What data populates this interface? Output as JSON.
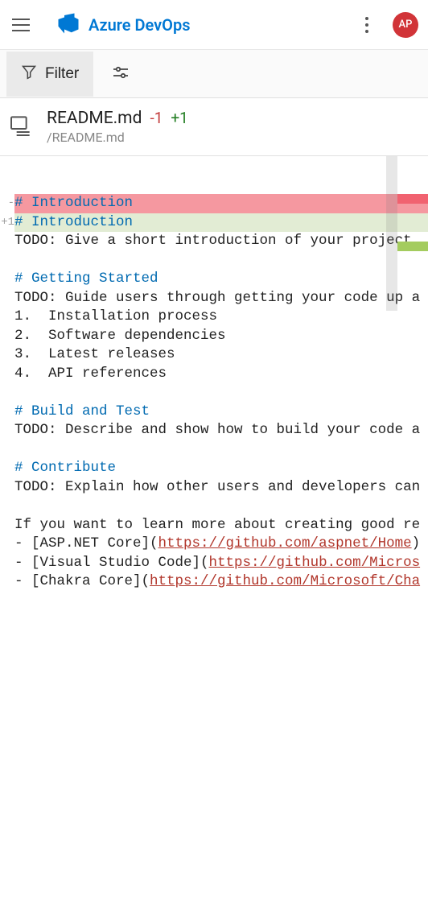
{
  "header": {
    "brand": "Azure DevOps",
    "avatar_initials": "AP"
  },
  "toolbar": {
    "filter_label": "Filter"
  },
  "file": {
    "name": "README.md",
    "removed": "-1",
    "added": "+1",
    "path": "/README.md"
  },
  "diff": {
    "lines": [
      {
        "type": "removed",
        "gutter": "-",
        "spans": [
          {
            "cls": "md-heading",
            "t": "# Introduction"
          }
        ]
      },
      {
        "type": "added",
        "gutter": "+1",
        "spans": [
          {
            "cls": "md-heading",
            "t": "# Introduction "
          }
        ]
      },
      {
        "type": "context",
        "gutter": "",
        "spans": [
          {
            "cls": "plain",
            "t": "TODO: Give a short introduction of your project"
          }
        ]
      },
      {
        "type": "context",
        "gutter": "",
        "spans": [
          {
            "cls": "plain",
            "t": ""
          }
        ]
      },
      {
        "type": "context",
        "gutter": "",
        "spans": [
          {
            "cls": "md-heading",
            "t": "# Getting Started"
          }
        ]
      },
      {
        "type": "context",
        "gutter": "",
        "spans": [
          {
            "cls": "plain",
            "t": "TODO: Guide users through getting your code up a"
          }
        ]
      },
      {
        "type": "context",
        "gutter": "",
        "spans": [
          {
            "cls": "plain",
            "t": "1.  Installation process"
          }
        ]
      },
      {
        "type": "context",
        "gutter": "",
        "spans": [
          {
            "cls": "plain",
            "t": "2.  Software dependencies"
          }
        ]
      },
      {
        "type": "context",
        "gutter": "",
        "spans": [
          {
            "cls": "plain",
            "t": "3.  Latest releases"
          }
        ]
      },
      {
        "type": "context",
        "gutter": "",
        "spans": [
          {
            "cls": "plain",
            "t": "4.  API references"
          }
        ]
      },
      {
        "type": "context",
        "gutter": "",
        "spans": [
          {
            "cls": "plain",
            "t": ""
          }
        ]
      },
      {
        "type": "context",
        "gutter": "",
        "spans": [
          {
            "cls": "md-heading",
            "t": "# Build and Test"
          }
        ]
      },
      {
        "type": "context",
        "gutter": "",
        "spans": [
          {
            "cls": "plain",
            "t": "TODO: Describe and show how to build your code a"
          }
        ]
      },
      {
        "type": "context",
        "gutter": "",
        "spans": [
          {
            "cls": "plain",
            "t": ""
          }
        ]
      },
      {
        "type": "context",
        "gutter": "",
        "spans": [
          {
            "cls": "md-heading",
            "t": "# Contribute"
          }
        ]
      },
      {
        "type": "context",
        "gutter": "",
        "spans": [
          {
            "cls": "plain",
            "t": "TODO: Explain how other users and developers can"
          }
        ]
      },
      {
        "type": "context",
        "gutter": "",
        "spans": [
          {
            "cls": "plain",
            "t": ""
          }
        ]
      },
      {
        "type": "context",
        "gutter": "",
        "spans": [
          {
            "cls": "plain",
            "t": "If you want to learn more about creating good re"
          }
        ]
      },
      {
        "type": "context",
        "gutter": "",
        "spans": [
          {
            "cls": "plain",
            "t": "- [ASP.NET Core]("
          },
          {
            "cls": "md-link-url",
            "t": "https://github.com/aspnet/Home"
          },
          {
            "cls": "plain",
            "t": ")"
          }
        ]
      },
      {
        "type": "context",
        "gutter": "",
        "spans": [
          {
            "cls": "plain",
            "t": "- [Visual Studio Code]("
          },
          {
            "cls": "md-link-url",
            "t": "https://github.com/Micros"
          }
        ]
      },
      {
        "type": "context",
        "gutter": "",
        "spans": [
          {
            "cls": "plain",
            "t": "- [Chakra Core]("
          },
          {
            "cls": "md-link-url",
            "t": "https://github.com/Microsoft/Cha"
          }
        ]
      }
    ]
  }
}
